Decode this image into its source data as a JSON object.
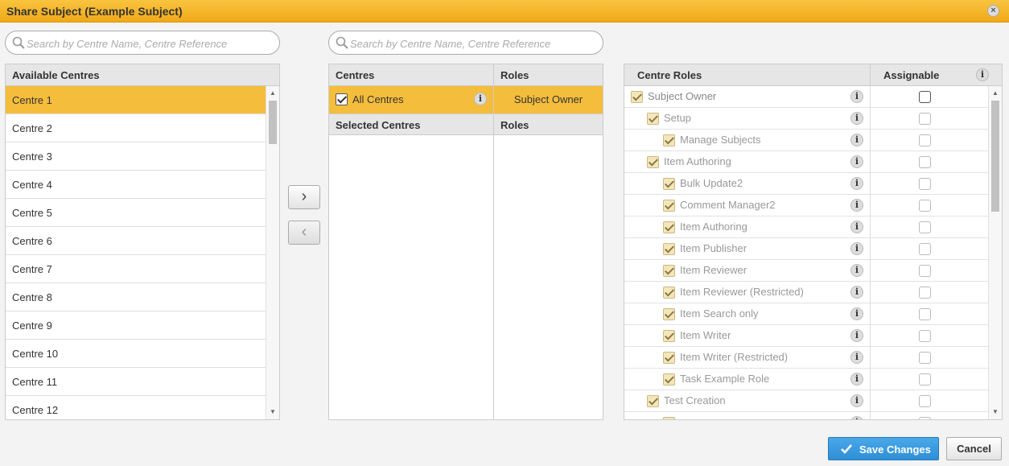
{
  "dialog": {
    "title": "Share Subject (Example Subject)",
    "close_glyph": "×"
  },
  "search_left": {
    "placeholder": "Search by Centre Name, Centre Reference"
  },
  "search_mid": {
    "placeholder": "Search by Centre Name, Centre Reference"
  },
  "available": {
    "header": "Available Centres",
    "selected_index": 0,
    "items": [
      "Centre 1",
      "Centre 2",
      "Centre 3",
      "Centre 4",
      "Centre 5",
      "Centre 6",
      "Centre 7",
      "Centre 8",
      "Centre 9",
      "Centre 10",
      "Centre 11",
      "Centre 12"
    ]
  },
  "transfer": {
    "add_glyph": "›",
    "remove_glyph": "‹"
  },
  "middle": {
    "col_centres": "Centres",
    "col_roles": "Roles",
    "all_centres_label": "All Centres",
    "all_centres_role": "Subject Owner",
    "selected_header": "Selected Centres",
    "selected_roles_header": "Roles",
    "info_glyph": "i"
  },
  "roles": {
    "col_roles": "Centre Roles",
    "col_assignable": "Assignable",
    "info_glyph": "i",
    "items": [
      {
        "label": "Subject Owner",
        "level": 0
      },
      {
        "label": "Setup",
        "level": 1
      },
      {
        "label": "Manage Subjects",
        "level": 2
      },
      {
        "label": "Item Authoring",
        "level": 1
      },
      {
        "label": "Bulk Update2",
        "level": 2
      },
      {
        "label": "Comment Manager2",
        "level": 2
      },
      {
        "label": "Item Authoring",
        "level": 2
      },
      {
        "label": "Item Publisher",
        "level": 2
      },
      {
        "label": "Item Reviewer",
        "level": 2
      },
      {
        "label": "Item Reviewer (Restricted)",
        "level": 2
      },
      {
        "label": "Item Search only",
        "level": 2
      },
      {
        "label": "Item Writer",
        "level": 2
      },
      {
        "label": "Item Writer (Restricted)",
        "level": 2
      },
      {
        "label": "Task Example Role",
        "level": 2
      },
      {
        "label": "Test Creation",
        "level": 1
      },
      {
        "label": "",
        "level": 2
      }
    ]
  },
  "footer": {
    "save_label": "Save Changes",
    "cancel_label": "Cancel"
  },
  "colors": {
    "accent": "#f5bd3c",
    "save": "#3a9be0"
  }
}
